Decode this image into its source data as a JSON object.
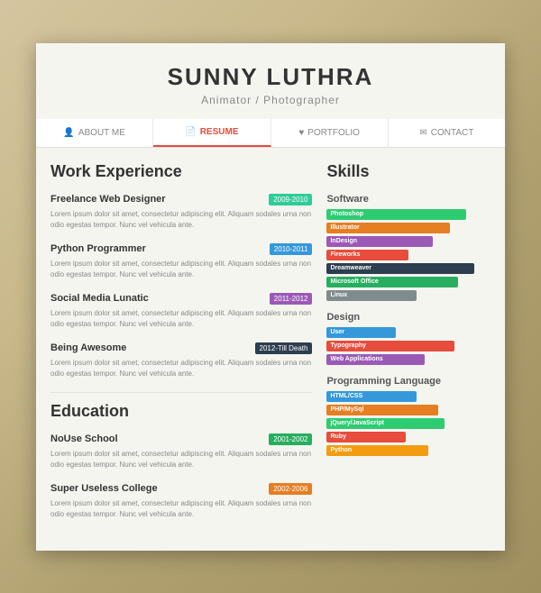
{
  "header": {
    "name": "SUNNY LUTHRA",
    "title": "Animator / Photographer"
  },
  "nav": {
    "tabs": [
      {
        "label": "ABOUT ME",
        "icon": "👤",
        "active": false
      },
      {
        "label": "RESUME",
        "icon": "📄",
        "active": true
      },
      {
        "label": "PORTFOLIO",
        "icon": "♥",
        "active": false
      },
      {
        "label": "CONTACT",
        "icon": "✉",
        "active": false
      }
    ]
  },
  "work_experience": {
    "section_title": "Work Experience",
    "items": [
      {
        "title": "Freelance Web Designer",
        "date": "2009-2010",
        "date_class": "date-teal",
        "desc": "Lorem ipsum dolor sit amet, consectetur adipiscing elit. Aliquam sodales urna non odio egestas tempor. Nunc vel vehicula ante."
      },
      {
        "title": "Python Programmer",
        "date": "2010-2011",
        "date_class": "date-blue",
        "desc": "Lorem ipsum dolor sit amet, consectetur adipiscing elit. Aliquam sodales urna non odio egestas tempor. Nunc vel vehicula ante."
      },
      {
        "title": "Social Media Lunatic",
        "date": "2011-2012",
        "date_class": "date-purple",
        "desc": "Lorem ipsum dolor sit amet, consectetur adipiscing elit. Aliquam sodales urna non odio egestas tempor. Nunc vel vehicula ante."
      },
      {
        "title": "Being Awesome",
        "date": "2012-Till Death",
        "date_class": "date-dark",
        "desc": "Lorem ipsum dolor sit amet, consectetur adipiscing elit. Aliquam sodales urna non odio egestas tempor. Nunc vel vehicula ante."
      }
    ]
  },
  "education": {
    "section_title": "Education",
    "items": [
      {
        "title": "NoUse School",
        "date": "2001-2002",
        "date_class": "date-green",
        "desc": "Lorem ipsum dolor sit amet, consectetur adipiscing elit. Aliquam sodales urna non odio egestas tempor. Nunc vel vehicula ante."
      },
      {
        "title": "Super Useless College",
        "date": "2002-2006",
        "date_class": "date-orange",
        "desc": "Lorem ipsum dolor sit amet, consectetur adipiscing elit. Aliquam sodales urna non odio egestas tempor. Nunc vel vehicula ante."
      }
    ]
  },
  "skills": {
    "section_title": "Skills",
    "software": {
      "subtitle": "Software",
      "bars": [
        {
          "label": "Photoshop",
          "class": "bar-photoshop"
        },
        {
          "label": "Illustrator",
          "class": "bar-illustrator"
        },
        {
          "label": "InDesign",
          "class": "bar-indesign"
        },
        {
          "label": "Fireworks",
          "class": "bar-fireworks"
        },
        {
          "label": "Dreamweaver",
          "class": "bar-dreamweaver"
        },
        {
          "label": "Microsoft Office",
          "class": "bar-msoffice"
        },
        {
          "label": "Linux",
          "class": "bar-linux"
        }
      ]
    },
    "design": {
      "subtitle": "Design",
      "bars": [
        {
          "label": "User",
          "class": "bar-user"
        },
        {
          "label": "Typography",
          "class": "bar-typography"
        },
        {
          "label": "Web Applications",
          "class": "bar-webapps"
        }
      ]
    },
    "programming": {
      "subtitle": "Programming Language",
      "bars": [
        {
          "label": "HTML/CSS",
          "class": "bar-htmlcss"
        },
        {
          "label": "PHP/MySql",
          "class": "bar-phpmysql"
        },
        {
          "label": "jQuery/JavaScript",
          "class": "bar-jquery"
        },
        {
          "label": "Ruby",
          "class": "bar-ruby"
        },
        {
          "label": "Python",
          "class": "bar-python"
        }
      ]
    }
  }
}
